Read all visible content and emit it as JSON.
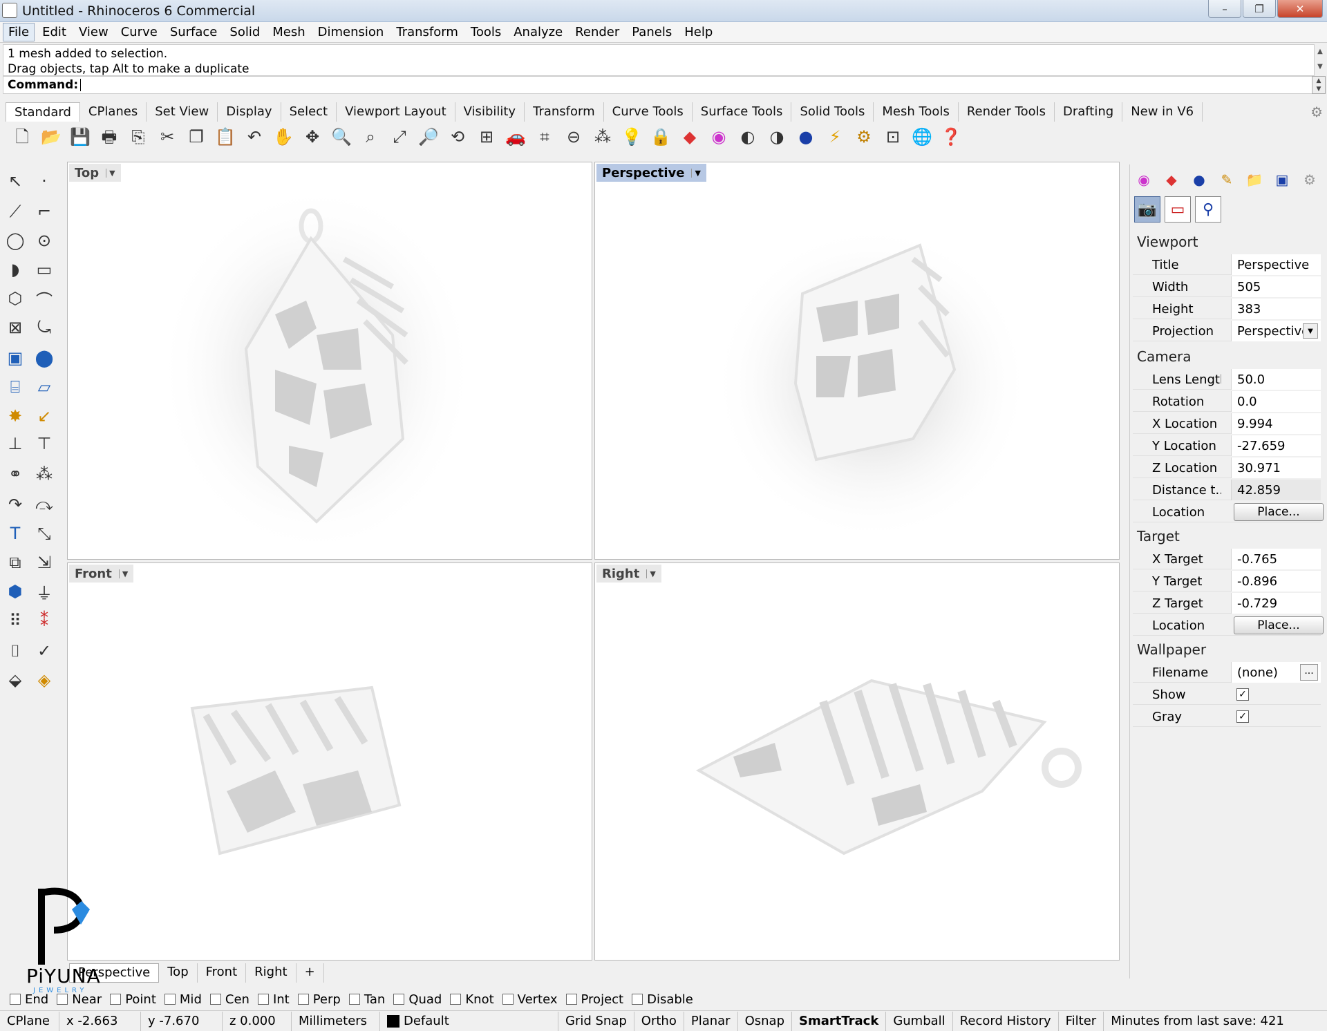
{
  "window": {
    "title": "Untitled - Rhinoceros 6 Commercial",
    "controls": [
      "–",
      "❐",
      "✕"
    ]
  },
  "menu": [
    "File",
    "Edit",
    "View",
    "Curve",
    "Surface",
    "Solid",
    "Mesh",
    "Dimension",
    "Transform",
    "Tools",
    "Analyze",
    "Render",
    "Panels",
    "Help"
  ],
  "command": {
    "history1": "1 mesh added to selection.",
    "history2": "Drag objects, tap Alt to make a duplicate",
    "prompt": "Command:"
  },
  "toolbar_tabs": [
    "Standard",
    "CPlanes",
    "Set View",
    "Display",
    "Select",
    "Viewport Layout",
    "Visibility",
    "Transform",
    "Curve Tools",
    "Surface Tools",
    "Solid Tools",
    "Mesh Tools",
    "Render Tools",
    "Drafting",
    "New in V6"
  ],
  "viewports": {
    "top": "Top",
    "perspective": "Perspective",
    "front": "Front",
    "right": "Right"
  },
  "properties": {
    "viewport_section": "Viewport",
    "title_label": "Title",
    "title_value": "Perspective",
    "width_label": "Width",
    "width_value": "505",
    "height_label": "Height",
    "height_value": "383",
    "projection_label": "Projection",
    "projection_value": "Perspective",
    "camera_section": "Camera",
    "lens_label": "Lens Length",
    "lens_value": "50.0",
    "rotation_label": "Rotation",
    "rotation_value": "0.0",
    "xloc_label": "X Location",
    "xloc_value": "9.994",
    "yloc_label": "Y Location",
    "yloc_value": "-27.659",
    "zloc_label": "Z Location",
    "zloc_value": "30.971",
    "dist_label": "Distance t...",
    "dist_value": "42.859",
    "camloc_label": "Location",
    "place_label": "Place...",
    "target_section": "Target",
    "xt_label": "X Target",
    "xt_value": "-0.765",
    "yt_label": "Y Target",
    "yt_value": "-0.896",
    "zt_label": "Z Target",
    "zt_value": "-0.729",
    "tloc_label": "Location",
    "wallpaper_section": "Wallpaper",
    "filename_label": "Filename",
    "filename_value": "(none)",
    "dots": "...",
    "show_label": "Show",
    "gray_label": "Gray"
  },
  "viewport_tabs": [
    "Perspective",
    "Top",
    "Front",
    "Right",
    "+"
  ],
  "osnaps": [
    "End",
    "Near",
    "Point",
    "Mid",
    "Cen",
    "Int",
    "Perp",
    "Tan",
    "Quad",
    "Knot",
    "Vertex",
    "Project",
    "Disable"
  ],
  "status": {
    "cplane": "CPlane",
    "x": "x -2.663",
    "y": "y -7.670",
    "z": "z 0.000",
    "units": "Millimeters",
    "layer": "Default",
    "grid": "Grid Snap",
    "ortho": "Ortho",
    "planar": "Planar",
    "osnap": "Osnap",
    "smarttrack": "SmartTrack",
    "gumball": "Gumball",
    "history": "Record History",
    "filter": "Filter",
    "save": "Minutes from last save: 421"
  },
  "logo": {
    "name": "PiYUNA",
    "tag": "JEWELRY"
  }
}
